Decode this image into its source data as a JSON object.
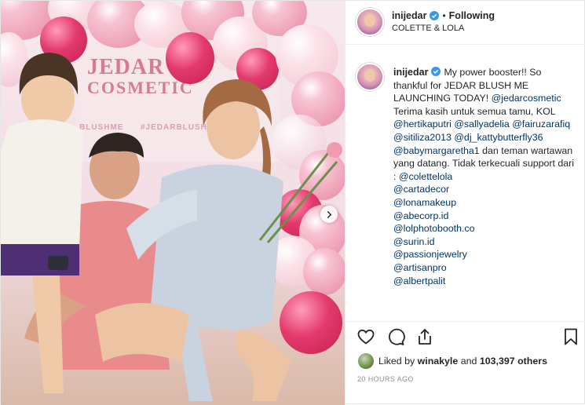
{
  "post": {
    "username": "inijedar",
    "follow_status": "Following",
    "location": "COLETTE & LOLA",
    "photo_alt": "",
    "photo_text": {
      "brand_line1": "JEDAR",
      "brand_line2": "COSMETIC",
      "hashtag": "#JEDARBLUSHME",
      "hashtag_short": "BLUSHME"
    }
  },
  "caption": {
    "username": "inijedar",
    "segments": [
      {
        "t": "text",
        "v": "My power booster!! So thankful for JEDAR BLUSH ME LAUNCHING TODAY! "
      },
      {
        "t": "mention",
        "v": "@jedarcosmetic"
      },
      {
        "t": "text",
        "v": " Terima kasih untuk semua tamu, KOL "
      },
      {
        "t": "mention",
        "v": "@hertikaputri"
      },
      {
        "t": "text",
        "v": " "
      },
      {
        "t": "mention",
        "v": "@sallyadelia"
      },
      {
        "t": "text",
        "v": " "
      },
      {
        "t": "mention",
        "v": "@fairuzarafiq"
      },
      {
        "t": "text",
        "v": " "
      },
      {
        "t": "mention",
        "v": "@sitiliza2013"
      },
      {
        "t": "text",
        "v": " "
      },
      {
        "t": "mention",
        "v": "@dj_kattybutterfly36"
      },
      {
        "t": "text",
        "v": " "
      },
      {
        "t": "mention",
        "v": "@babymargaretha1"
      },
      {
        "t": "text",
        "v": " dan teman wartawan yang datang. Tidak terkecuali support dari : "
      },
      {
        "t": "mention",
        "v": "@colettelola"
      },
      {
        "t": "br"
      },
      {
        "t": "mention",
        "v": "@cartadecor"
      },
      {
        "t": "br"
      },
      {
        "t": "mention",
        "v": "@lonamakeup"
      },
      {
        "t": "br"
      },
      {
        "t": "mention",
        "v": "@abecorp.id"
      },
      {
        "t": "br"
      },
      {
        "t": "mention",
        "v": "@lolphotobooth.co"
      },
      {
        "t": "br"
      },
      {
        "t": "mention",
        "v": "@surin.id"
      },
      {
        "t": "br"
      },
      {
        "t": "mention",
        "v": "@passionjewelry"
      },
      {
        "t": "br"
      },
      {
        "t": "mention",
        "v": "@artisanpro"
      },
      {
        "t": "br"
      },
      {
        "t": "mention",
        "v": "@albertpalit"
      }
    ]
  },
  "actions": {
    "like_icon": "heart-icon",
    "comment_icon": "comment-icon",
    "share_icon": "share-icon",
    "save_icon": "bookmark-icon"
  },
  "likes": {
    "prefix": "Liked by",
    "user": "winakyle",
    "joiner": "and",
    "count": "103,397 others"
  },
  "timestamp": "20 HOURS AGO",
  "colors": {
    "link": "#003569",
    "verified": "#3897f0",
    "meta": "#8e8e8e"
  }
}
